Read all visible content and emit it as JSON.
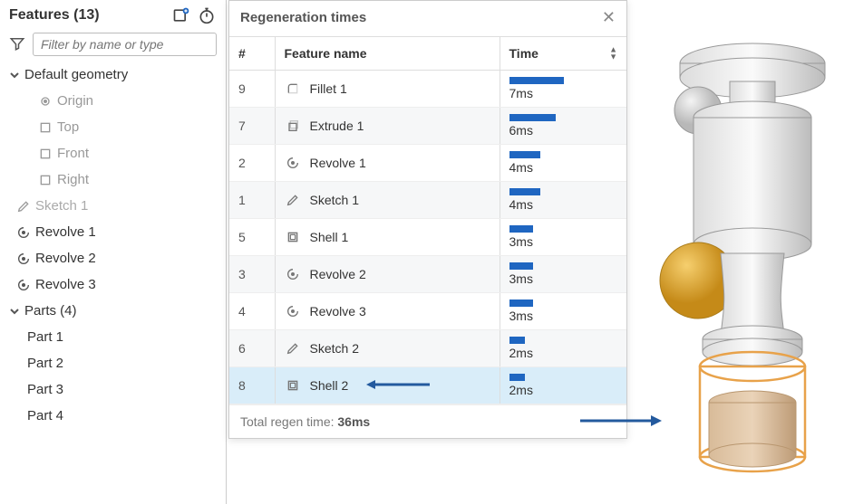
{
  "sidebar": {
    "title": "Features (13)",
    "filter_placeholder": "Filter by name or type",
    "default_geometry_label": "Default geometry",
    "geometry_children": [
      {
        "label": "Origin",
        "icon": "origin"
      },
      {
        "label": "Top",
        "icon": "plane"
      },
      {
        "label": "Front",
        "icon": "plane"
      },
      {
        "label": "Right",
        "icon": "plane"
      }
    ],
    "features": [
      {
        "label": "Sketch 1",
        "icon": "pencil",
        "dim": true
      },
      {
        "label": "Revolve 1",
        "icon": "revolve"
      },
      {
        "label": "Revolve 2",
        "icon": "revolve"
      },
      {
        "label": "Revolve 3",
        "icon": "revolve"
      }
    ],
    "parts_header": "Parts (4)",
    "parts": [
      {
        "label": "Part 1"
      },
      {
        "label": "Part 2"
      },
      {
        "label": "Part 3"
      },
      {
        "label": "Part 4"
      }
    ]
  },
  "dialog": {
    "title": "Regeneration times",
    "columns": {
      "num": "#",
      "name": "Feature name",
      "time": "Time"
    },
    "max_ms": 7,
    "rows": [
      {
        "num": "9",
        "name": "Fillet 1",
        "icon": "fillet",
        "ms": 7,
        "time_label": "7ms"
      },
      {
        "num": "7",
        "name": "Extrude 1",
        "icon": "extrude",
        "ms": 6,
        "time_label": "6ms"
      },
      {
        "num": "2",
        "name": "Revolve 1",
        "icon": "revolve",
        "ms": 4,
        "time_label": "4ms"
      },
      {
        "num": "1",
        "name": "Sketch 1",
        "icon": "pencil",
        "ms": 4,
        "time_label": "4ms"
      },
      {
        "num": "5",
        "name": "Shell 1",
        "icon": "shell",
        "ms": 3,
        "time_label": "3ms"
      },
      {
        "num": "3",
        "name": "Revolve 2",
        "icon": "revolve",
        "ms": 3,
        "time_label": "3ms"
      },
      {
        "num": "4",
        "name": "Revolve 3",
        "icon": "revolve",
        "ms": 3,
        "time_label": "3ms"
      },
      {
        "num": "6",
        "name": "Sketch 2",
        "icon": "pencil",
        "ms": 2,
        "time_label": "2ms"
      },
      {
        "num": "8",
        "name": "Shell 2",
        "icon": "shell",
        "ms": 2,
        "time_label": "2ms",
        "highlight": true
      }
    ],
    "footer_prefix": "Total regen time: ",
    "footer_value": "36ms"
  },
  "annotation": {
    "arrow_row": "→",
    "arrow_model": "→"
  },
  "colors": {
    "bar": "#1f66c1",
    "arrow": "#235a9e",
    "highlight": "#d9edf9",
    "gold": "#d9a22b",
    "tan": "#c9a178",
    "outline": "#e8a24a"
  }
}
